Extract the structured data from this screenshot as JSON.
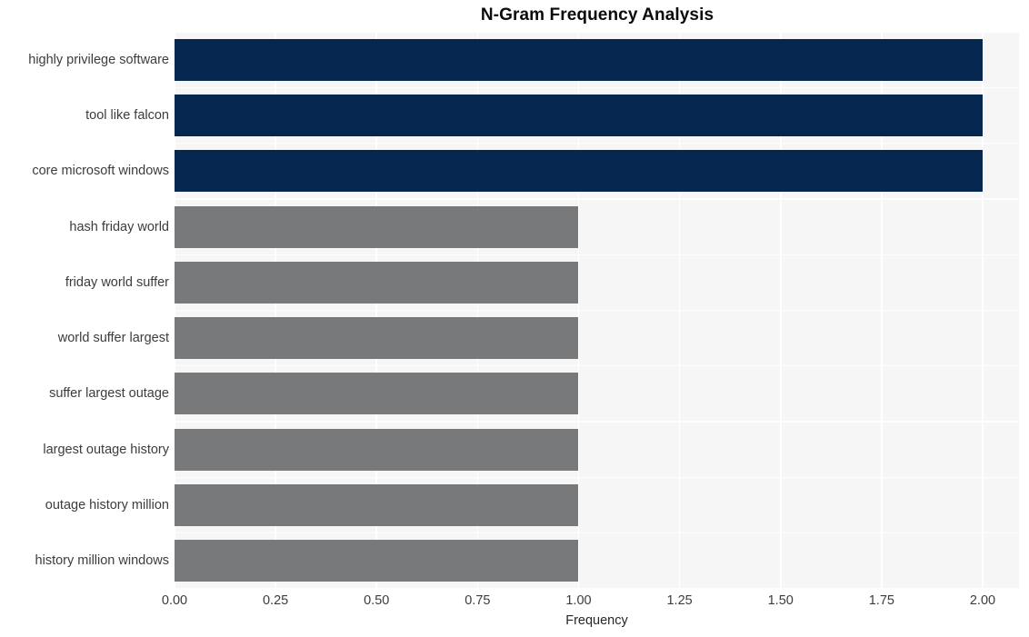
{
  "chart_data": {
    "type": "bar",
    "orientation": "horizontal",
    "title": "N-Gram Frequency Analysis",
    "xlabel": "Frequency",
    "ylabel": "",
    "xlim": [
      0,
      2.09
    ],
    "xticks": [
      0,
      0.25,
      0.5,
      0.75,
      1.0,
      1.25,
      1.5,
      1.75,
      2.0
    ],
    "xtick_labels": [
      "0.00",
      "0.25",
      "0.50",
      "0.75",
      "1.00",
      "1.25",
      "1.50",
      "1.75",
      "2.00"
    ],
    "grid": true,
    "legend": "none",
    "categories": [
      "highly privilege software",
      "tool like falcon",
      "core microsoft windows",
      "hash friday world",
      "friday world suffer",
      "world suffer largest",
      "suffer largest outage",
      "largest outage history",
      "outage history million",
      "history million windows"
    ],
    "values": [
      2,
      2,
      2,
      1,
      1,
      1,
      1,
      1,
      1,
      1
    ],
    "bar_colors": [
      "#04264f",
      "#04264f",
      "#04264f",
      "#78797a",
      "#78797a",
      "#78797a",
      "#78797a",
      "#78797a",
      "#78797a",
      "#78797a"
    ],
    "palette": {
      "highlight": "#04264f",
      "normal": "#78797a",
      "plot_background": "#f6f6f7",
      "figure_background": "#ffffff",
      "gridline": "#ffffff",
      "tick_text": "#3c3c3c",
      "title_text": "#0b0b0b"
    }
  }
}
